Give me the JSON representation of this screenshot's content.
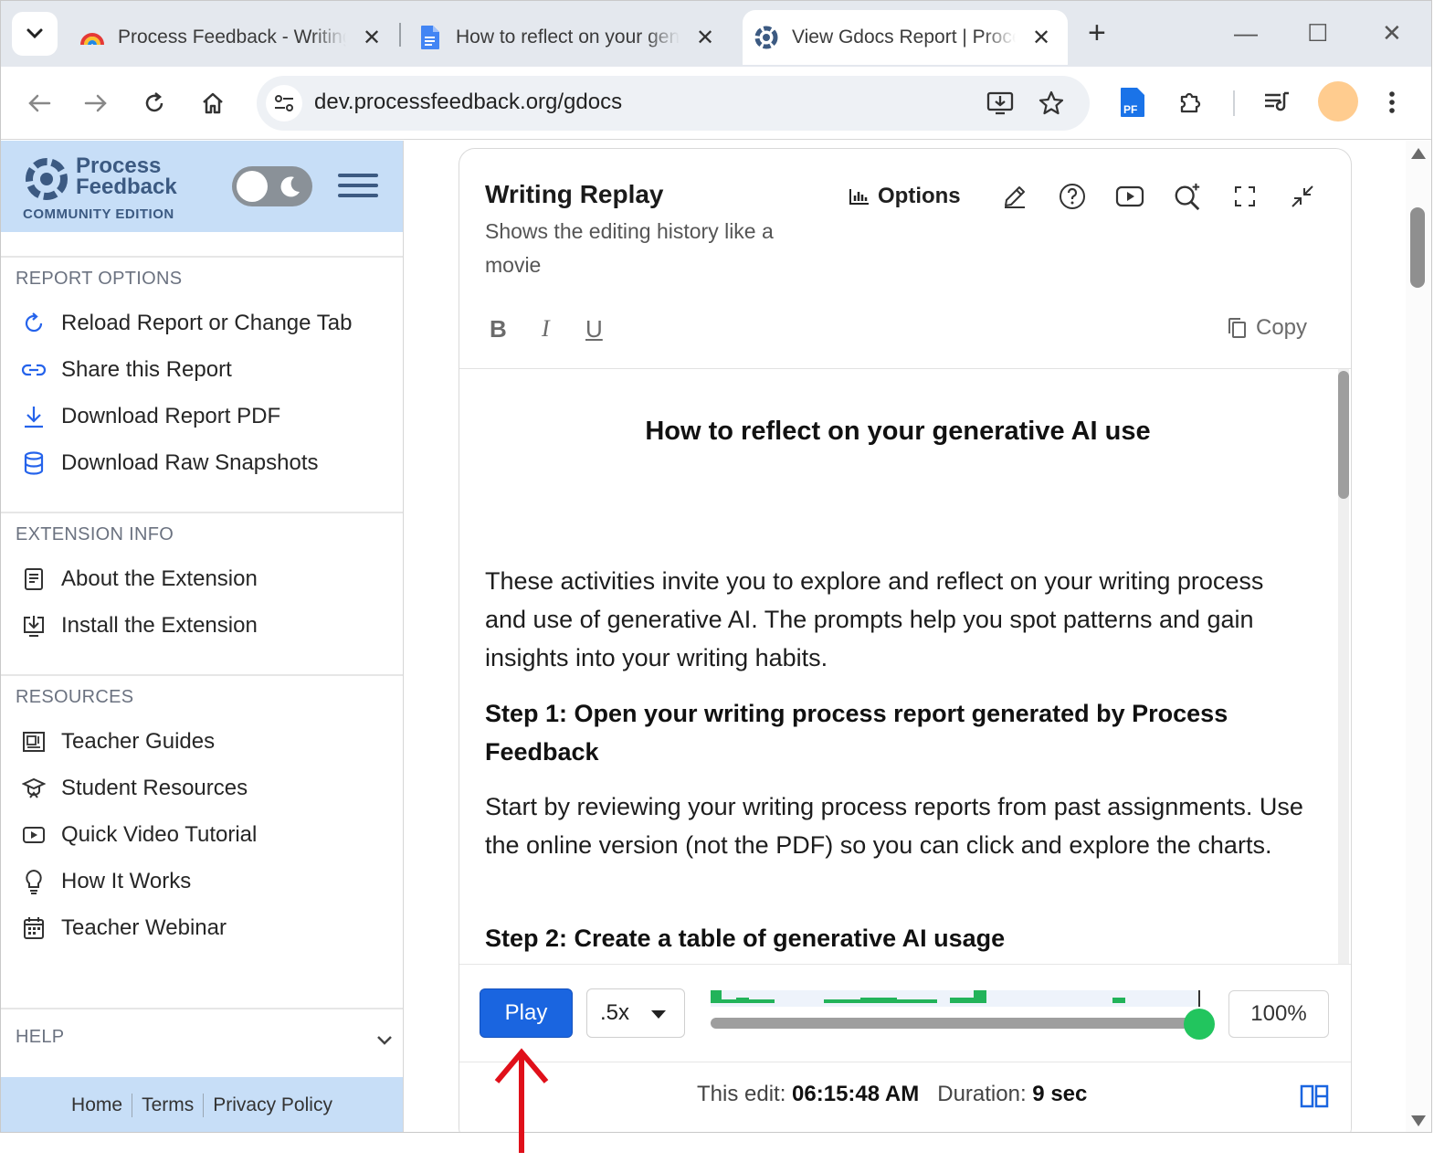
{
  "browser": {
    "tabs": [
      {
        "title": "Process Feedback - Writing",
        "active": false
      },
      {
        "title": "How to reflect on your generative AI use",
        "active": false
      },
      {
        "title": "View Gdocs Report | Process Feedback",
        "active": true
      }
    ],
    "url": "dev.processfeedback.org/gdocs",
    "extension_badge": "PF"
  },
  "sidebar": {
    "logo_line1": "Process",
    "logo_line2": "Feedback",
    "logo_sub": "COMMUNITY EDITION",
    "sections": {
      "report_options": {
        "title": "REPORT OPTIONS",
        "items": [
          {
            "label": "Reload Report or Change Tab",
            "icon": "reload-icon"
          },
          {
            "label": "Share this Report",
            "icon": "link-icon"
          },
          {
            "label": "Download Report PDF",
            "icon": "download-icon"
          },
          {
            "label": "Download Raw Snapshots",
            "icon": "database-icon"
          }
        ]
      },
      "extension_info": {
        "title": "EXTENSION INFO",
        "items": [
          {
            "label": "About the Extension",
            "icon": "document-icon"
          },
          {
            "label": "Install the Extension",
            "icon": "install-icon"
          }
        ]
      },
      "resources": {
        "title": "RESOURCES",
        "items": [
          {
            "label": "Teacher Guides",
            "icon": "guide-icon"
          },
          {
            "label": "Student Resources",
            "icon": "student-icon"
          },
          {
            "label": "Quick Video Tutorial",
            "icon": "video-icon"
          },
          {
            "label": "How It Works",
            "icon": "lightbulb-icon"
          },
          {
            "label": "Teacher Webinar",
            "icon": "calendar-icon"
          }
        ]
      },
      "help": {
        "title": "HELP"
      }
    },
    "footer": {
      "home": "Home",
      "terms": "Terms",
      "privacy": "Privacy Policy"
    }
  },
  "card": {
    "title": "Writing Replay",
    "subtitle": "Shows the editing history like a movie",
    "options_label": "Options",
    "format": {
      "bold": "B",
      "italic": "I",
      "underline": "U"
    },
    "copy_label": "Copy"
  },
  "document": {
    "heading": "How to reflect on your generative AI use",
    "intro": "These activities invite you to explore and reflect on your writing process and use of generative AI. The prompts help you spot patterns and gain insights into your writing habits.",
    "step1_title": "Step 1: Open your writing process report generated by Process Feedback",
    "step1_body": "Start by reviewing your writing process reports from past assignments. Use the online version (not the PDF) so you can click and explore the charts.",
    "step2_title": "Step 2: Create a table of generative AI usage"
  },
  "player": {
    "play_label": "Play",
    "speed": ".5x",
    "progress_percent": "100%",
    "progress_value": 1.0,
    "edit_label": "This edit:",
    "edit_time": "06:15:48 AM",
    "duration_label": "Duration:",
    "duration_value": "9 sec"
  },
  "colors": {
    "accent_blue": "#1a65e0",
    "sidebar_header": "#c7def7",
    "timeline_green": "#22b35a",
    "annotation_red": "#e0101a"
  }
}
